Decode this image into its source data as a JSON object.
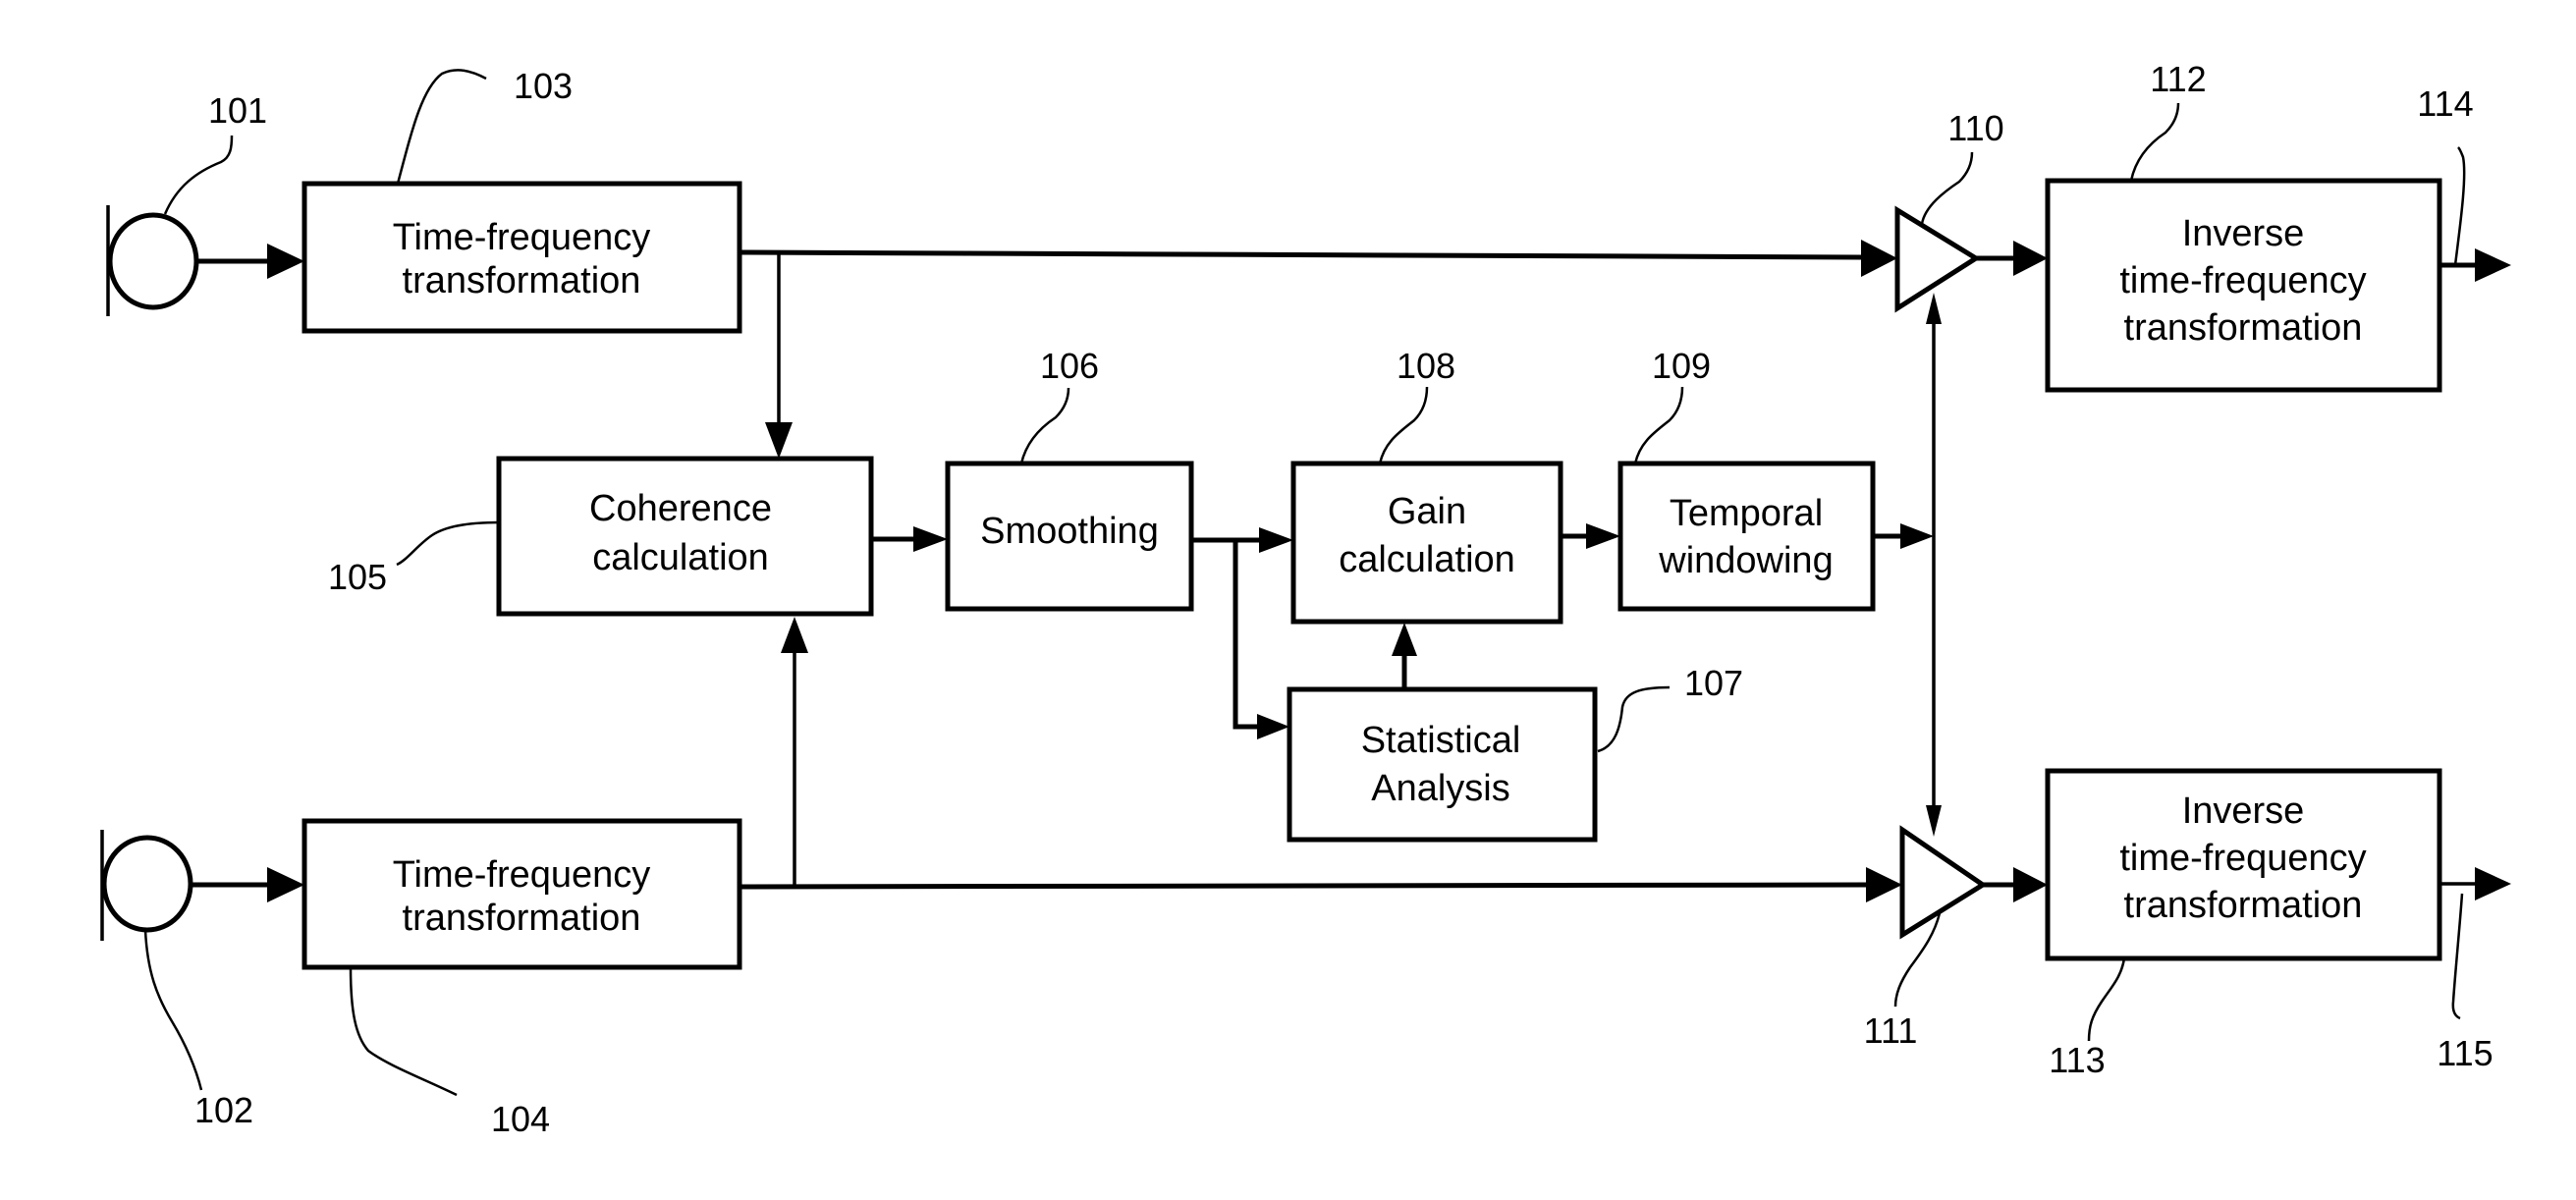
{
  "figure": {
    "type": "block-diagram",
    "description": "Two-microphone coherence-based gain processing"
  },
  "blocks": {
    "tf1": {
      "ref": "103",
      "lines": [
        "Time-frequency",
        "transformation"
      ]
    },
    "tf2": {
      "ref": "104",
      "lines": [
        "Time-frequency",
        "transformation"
      ]
    },
    "coherence": {
      "ref": "105",
      "lines": [
        "Coherence",
        "calculation"
      ]
    },
    "smoothing": {
      "ref": "106",
      "lines": [
        "Smoothing"
      ]
    },
    "statistical": {
      "ref": "107",
      "lines": [
        "Statistical",
        "Analysis"
      ]
    },
    "gain": {
      "ref": "108",
      "lines": [
        "Gain",
        "calculation"
      ]
    },
    "temporal": {
      "ref": "109",
      "lines": [
        "Temporal",
        "windowing"
      ]
    },
    "itf1": {
      "ref": "112",
      "lines": [
        "Inverse",
        "time-frequency",
        "transformation"
      ]
    },
    "itf2": {
      "ref": "113",
      "lines": [
        "Inverse",
        "time-frequency",
        "transformation"
      ]
    }
  },
  "components": {
    "mic1": {
      "ref": "101",
      "kind": "microphone"
    },
    "mic2": {
      "ref": "102",
      "kind": "microphone"
    },
    "amp1": {
      "ref": "110",
      "kind": "multiplier"
    },
    "amp2": {
      "ref": "111",
      "kind": "multiplier"
    },
    "out1": {
      "ref": "114",
      "kind": "output"
    },
    "out2": {
      "ref": "115",
      "kind": "output"
    }
  },
  "connections": [
    [
      "mic1",
      "tf1"
    ],
    [
      "mic2",
      "tf2"
    ],
    [
      "tf1",
      "coherence"
    ],
    [
      "tf2",
      "coherence"
    ],
    [
      "tf1",
      "amp1"
    ],
    [
      "tf2",
      "amp2"
    ],
    [
      "coherence",
      "smoothing"
    ],
    [
      "smoothing",
      "gain"
    ],
    [
      "smoothing",
      "statistical"
    ],
    [
      "statistical",
      "gain"
    ],
    [
      "gain",
      "temporal"
    ],
    [
      "temporal",
      "amp1"
    ],
    [
      "temporal",
      "amp2"
    ],
    [
      "amp1",
      "itf1"
    ],
    [
      "amp2",
      "itf2"
    ],
    [
      "itf1",
      "out1"
    ],
    [
      "itf2",
      "out2"
    ]
  ]
}
